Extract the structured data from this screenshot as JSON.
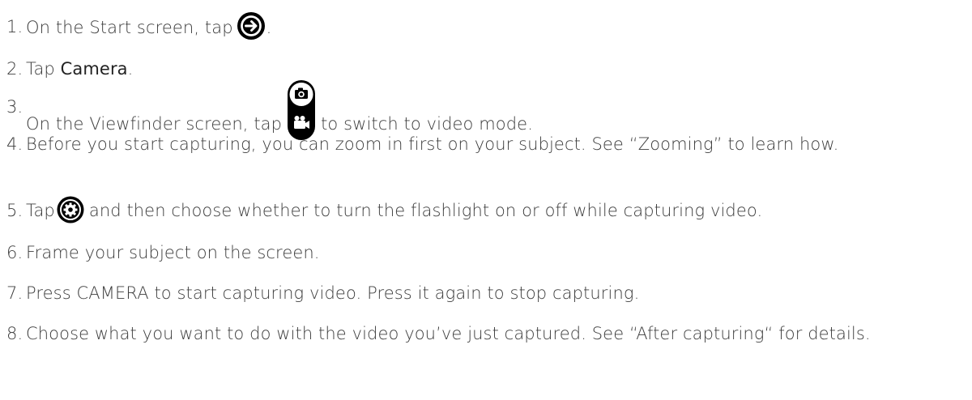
{
  "steps": [
    {
      "number": "1.",
      "before": "On the Start screen, tap",
      "after": ".",
      "icon": "arrow-right-circle-icon"
    },
    {
      "number": "2.",
      "before": "Tap ",
      "bold": "Camera",
      "after": "."
    },
    {
      "number": "3.",
      "before": "On the Viewfinder screen, tap",
      "after": "to switch to video mode.",
      "icon": "camera-video-toggle-icon"
    },
    {
      "number": "4.",
      "text": "Before you start capturing, you can zoom in first on your subject. See “Zooming” to learn how."
    },
    {
      "number": "5.",
      "before": "Tap",
      "after": "and then choose whether to turn the flashlight on or off while capturing video.",
      "icon": "settings-gear-icon"
    },
    {
      "number": "6.",
      "text": "Frame your subject on the screen."
    },
    {
      "number": "7.",
      "text": "Press CAMERA to start capturing video. Press it again to stop capturing."
    },
    {
      "number": "8.",
      "text": "Choose what you want to do with the video you’ve just captured. See “After capturing“ for details."
    }
  ]
}
